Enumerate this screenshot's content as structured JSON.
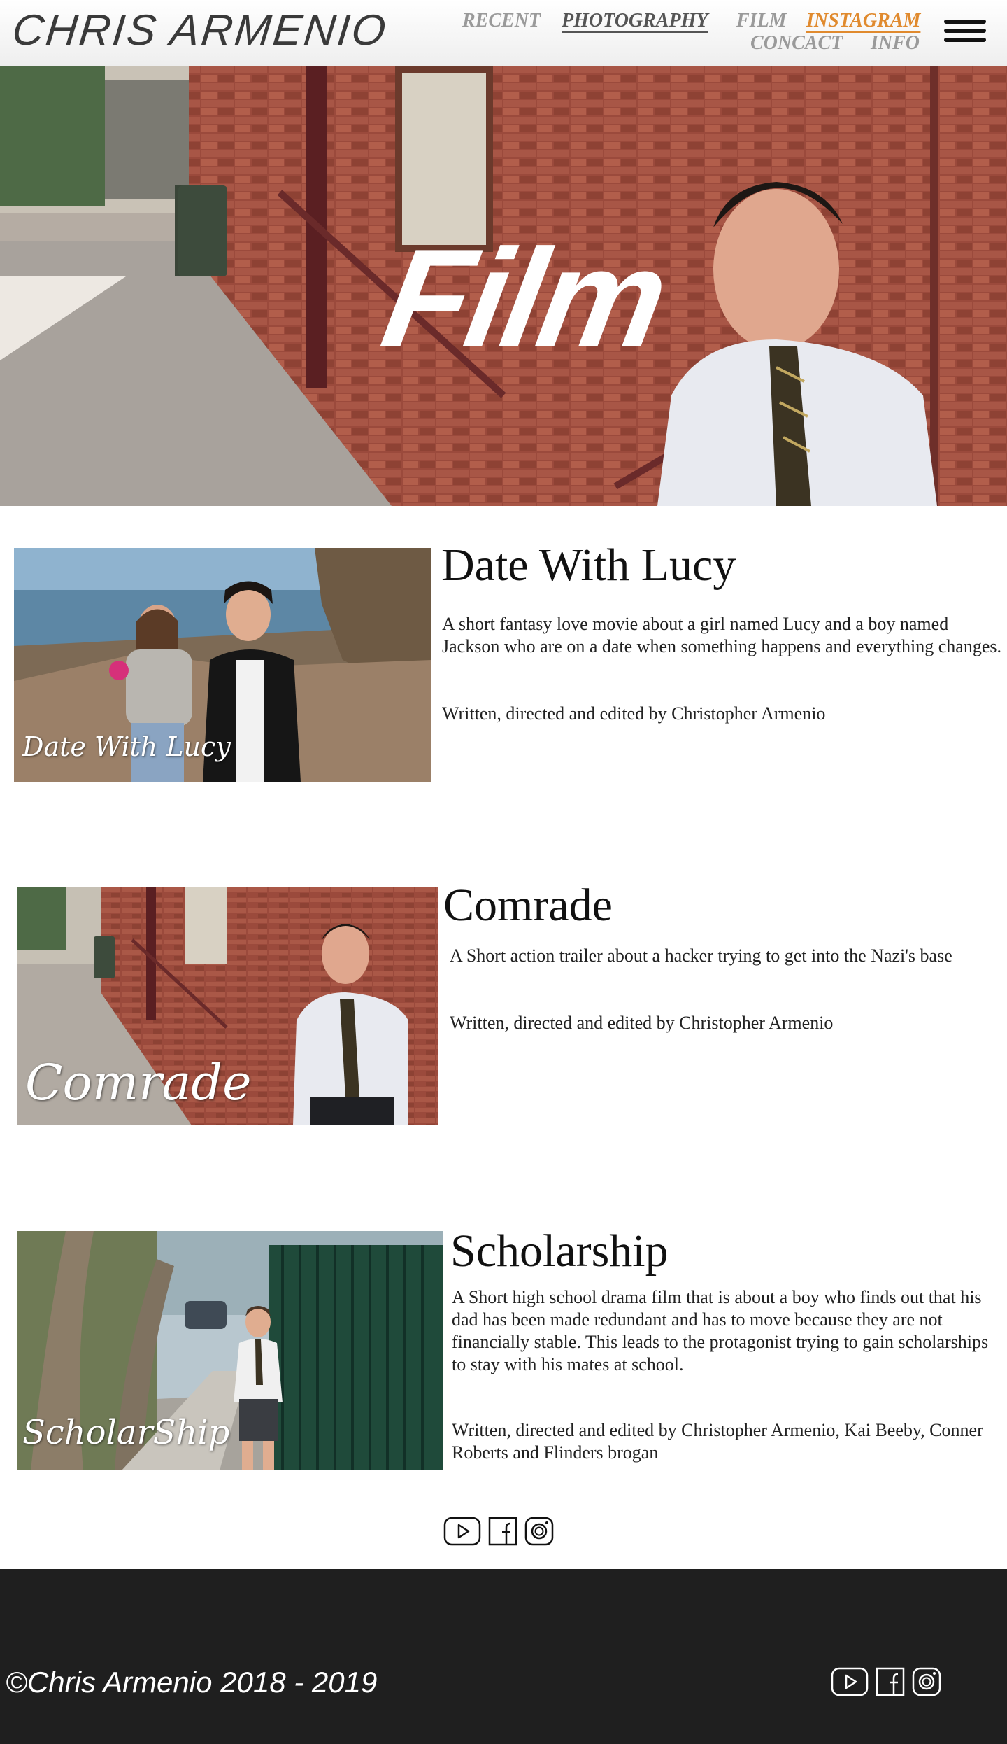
{
  "site": {
    "logo": "CHRIS ARMENIO"
  },
  "nav": {
    "recent": "RECENT",
    "photography": "PHOTOGRAPHY",
    "film": "FILM",
    "instagram": "INSTAGRAM",
    "concact": "CONCACT",
    "info": "INFO"
  },
  "hero": {
    "title": "Film"
  },
  "films": [
    {
      "thumb_caption": "Date With Lucy",
      "title": "Date With Lucy",
      "description": "A short fantasy love movie about a girl named Lucy and a boy named Jackson who are on a date when something happens and everything changes.",
      "credit": "Written, directed and edited by Christopher Armenio"
    },
    {
      "thumb_caption": "Comrade",
      "title": "Comrade",
      "description": "A Short action trailer about a hacker trying to get into the Nazi's base",
      "credit": "Written, directed and edited by Christopher Armenio"
    },
    {
      "thumb_caption": "ScholarShip",
      "title": "Scholarship",
      "description": "A Short high school drama film that is about a boy who finds out that his dad has been made redundant and has to move because they are not financially stable. This leads to the protagonist trying to gain scholarships to stay with his mates at school.",
      "credit": "Written, directed and edited by Christopher Armenio, Kai Beeby, Conner Roberts and Flinders brogan"
    }
  ],
  "footer": {
    "copyright": "©Chris Armenio 2018 - 2019"
  },
  "colors": {
    "instagram_accent": "#e08a2e",
    "footer_bg": "#1f1f1f"
  },
  "icons": [
    "youtube-icon",
    "facebook-icon",
    "instagram-icon",
    "hamburger-menu-icon"
  ]
}
